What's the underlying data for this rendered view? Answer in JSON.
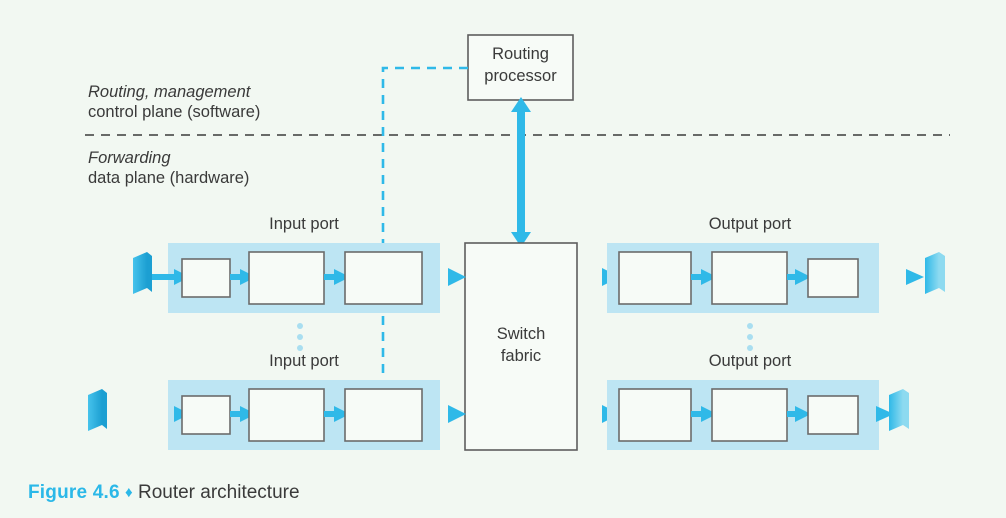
{
  "figure": {
    "caption_number": "Figure 4.6",
    "caption_diamond": "♦",
    "caption_title": "Router architecture"
  },
  "planes": {
    "control": {
      "line1": "Routing, management",
      "line2": "control plane (software)"
    },
    "data": {
      "line1": "Forwarding",
      "line2": "data plane (hardware)"
    },
    "divider": "dashed-horizontal-divider"
  },
  "nodes": {
    "routing_processor": {
      "line1": "Routing",
      "line2": "processor"
    },
    "switch_fabric": {
      "line1": "Switch",
      "line2": "fabric"
    }
  },
  "ports": {
    "input_top_label": "Input port",
    "input_bottom_label": "Input port",
    "output_top_label": "Output port",
    "output_bottom_label": "Output port",
    "input_stage_count": 3,
    "output_stage_count": 3,
    "vertical_ellipsis": "⋮"
  },
  "colors": {
    "background": "#f2f8f2",
    "accent_blue": "#2fb9e8",
    "port_band": "#bde5f3",
    "box_stroke": "#6b6b6b",
    "text": "#3a3a3a",
    "divider": "#3a3a3a",
    "connector_light": "#7fd4ef",
    "connector_dark": "#1896c8",
    "box_fill": "#f7fbf7"
  }
}
